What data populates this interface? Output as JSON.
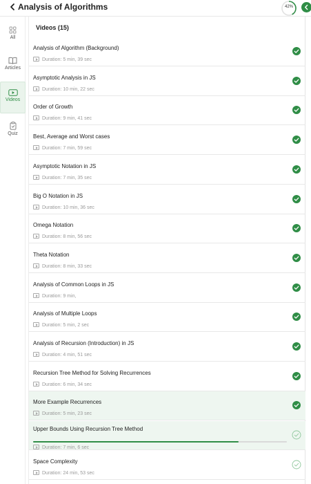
{
  "header": {
    "title": "Analysis of Algorithms",
    "progress_label": "42%",
    "progress": 0.42
  },
  "sidebar": {
    "items": [
      {
        "label": "All",
        "icon": "grid-icon",
        "active": false
      },
      {
        "label": "Articles",
        "icon": "book-icon",
        "active": false
      },
      {
        "label": "Videos",
        "icon": "video-icon",
        "active": true
      },
      {
        "label": "Quiz",
        "icon": "clipboard-icon",
        "active": false
      }
    ]
  },
  "section": {
    "title": "Videos (15)"
  },
  "videos": [
    {
      "title": "Analysis of Algorithm (Background)",
      "duration": "Duration: 5 min, 39 sec",
      "status": "completed"
    },
    {
      "title": "Asymptotic Analysis in JS",
      "duration": "Duration: 10 min, 22 sec",
      "status": "completed"
    },
    {
      "title": "Order of Growth",
      "duration": "Duration: 9 min, 41 sec",
      "status": "completed"
    },
    {
      "title": "Best, Average and Worst cases",
      "duration": "Duration: 7 min, 59 sec",
      "status": "completed"
    },
    {
      "title": "Asymptotic Notation in JS",
      "duration": "Duration: 7 min, 35 sec",
      "status": "completed"
    },
    {
      "title": "Big O Notation in JS",
      "duration": "Duration: 10 min, 36 sec",
      "status": "completed"
    },
    {
      "title": "Omega Notation",
      "duration": "Duration: 8 min, 56 sec",
      "status": "completed"
    },
    {
      "title": "Theta Notation",
      "duration": "Duration: 8 min, 33 sec",
      "status": "completed"
    },
    {
      "title": "Analysis of Common Loops in JS",
      "duration": "Duration: 9 min,",
      "status": "completed"
    },
    {
      "title": "Analysis of Multiple Loops",
      "duration": "Duration: 5 min, 2 sec",
      "status": "completed"
    },
    {
      "title": "Analysis of Recursion (Introduction) in JS",
      "duration": "Duration: 4 min, 51 sec",
      "status": "completed"
    },
    {
      "title": "Recursion Tree Method for Solving Recurrences",
      "duration": "Duration: 6 min, 34 sec",
      "status": "completed"
    },
    {
      "title": "More Example Recurrences",
      "duration": "Duration: 5 min, 23 sec",
      "status": "completed",
      "highlighted": true
    },
    {
      "title": "Upper Bounds Using Recursion Tree Method",
      "duration": "Duration: 7 min, 6 sec",
      "status": "in-progress",
      "highlighted": true,
      "watched": 0.81
    },
    {
      "title": "Space Complexity",
      "duration": "Duration: 24 min, 53 sec",
      "status": "not-started"
    }
  ],
  "colors": {
    "accent": "#2f8d46",
    "highlight_bg": "#eef6f0",
    "muted_text": "#999999"
  }
}
